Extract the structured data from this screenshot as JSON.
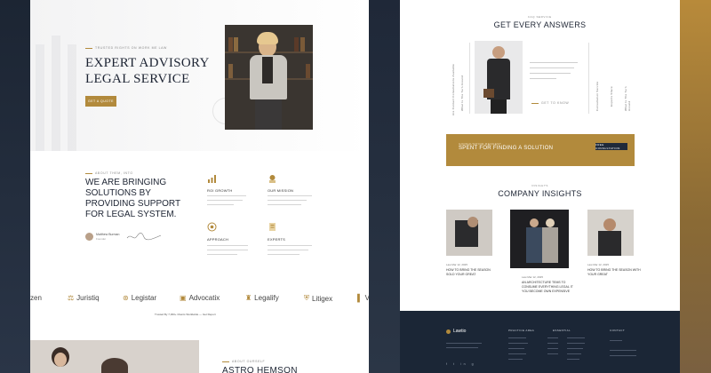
{
  "left_page": {
    "hero": {
      "eyebrow": "Trusted Rights on Work Me Law",
      "title": "EXPERT ADVISORY LEGAL SERVICE",
      "button_label": "Get a Quote"
    },
    "about": {
      "eyebrow": "About Them, Into",
      "title": "WE ARE BRINGING SOLUTIONS BY PROVIDING SUPPORT FOR LEGAL SYSTEM.",
      "author_name": "Matthew Burman",
      "author_role": "Founder",
      "features": [
        {
          "icon": "chart-icon",
          "title": "ROI GROWTH"
        },
        {
          "icon": "medal-icon",
          "title": "OUR MISSION"
        },
        {
          "icon": "target-icon",
          "title": "APPROACH"
        },
        {
          "icon": "document-icon",
          "title": "EXPERTS"
        }
      ]
    },
    "brands": [
      {
        "name": "zen",
        "icon": ""
      },
      {
        "name": "Juristiq",
        "icon": "⚖"
      },
      {
        "name": "Legistar",
        "icon": "⊛"
      },
      {
        "name": "Advocatix",
        "icon": "▣"
      },
      {
        "name": "Legalify",
        "icon": "♜"
      },
      {
        "name": "Litigex",
        "icon": "⛨"
      },
      {
        "name": "V",
        "icon": "▌"
      }
    ],
    "brands_note": "Trusted By 7,000+ Clients Worldwide — Get Report",
    "bottom": {
      "eyebrow": "About Ourself",
      "name": "ASTRO HEMSON"
    }
  },
  "right_page": {
    "faq": {
      "eyebrow": "Faq Service",
      "title": "GET EVERY ANSWERS",
      "vertical_left": "Are Contact Consultations Available",
      "vertical_left2": "What Is The Turn Around",
      "vertical_right": "Consultation Service",
      "vertical_right2": "Experts Share",
      "photo_caption": "Get To Know"
    },
    "cta": {
      "eyebrow": "Consultation Request",
      "title": "SPENT FOR FINDING A SOLUTION",
      "button_label": "Free Consultation"
    },
    "insights": {
      "eyebrow": "Insights",
      "title": "COMPANY INSIGHTS",
      "items": [
        {
          "meta": "Law     Mar 12, 2025",
          "title": "HOW TO BRING THE SEASON SOLD YOUR GREAT"
        },
        {
          "meta": "Law     Mar 12, 2025",
          "title": "AN ARCHITECTURE TEMS TO CONSUME EVERYTHING LEGAL IT YOU BECOME OWN EXPENSIVE"
        },
        {
          "meta": "Law     Mar 12, 2025",
          "title": "HOW TO BRING THE SEASON WITH YOUR GREAT"
        }
      ]
    },
    "footer": {
      "logo": "Lawtio",
      "columns": [
        "Practice Area",
        "Essential",
        "Contact"
      ],
      "social": "f  t  in  g"
    }
  },
  "colors": {
    "accent_gold": "#b28a3c",
    "navy": "#1b2636",
    "text_dark": "#1d2433"
  }
}
